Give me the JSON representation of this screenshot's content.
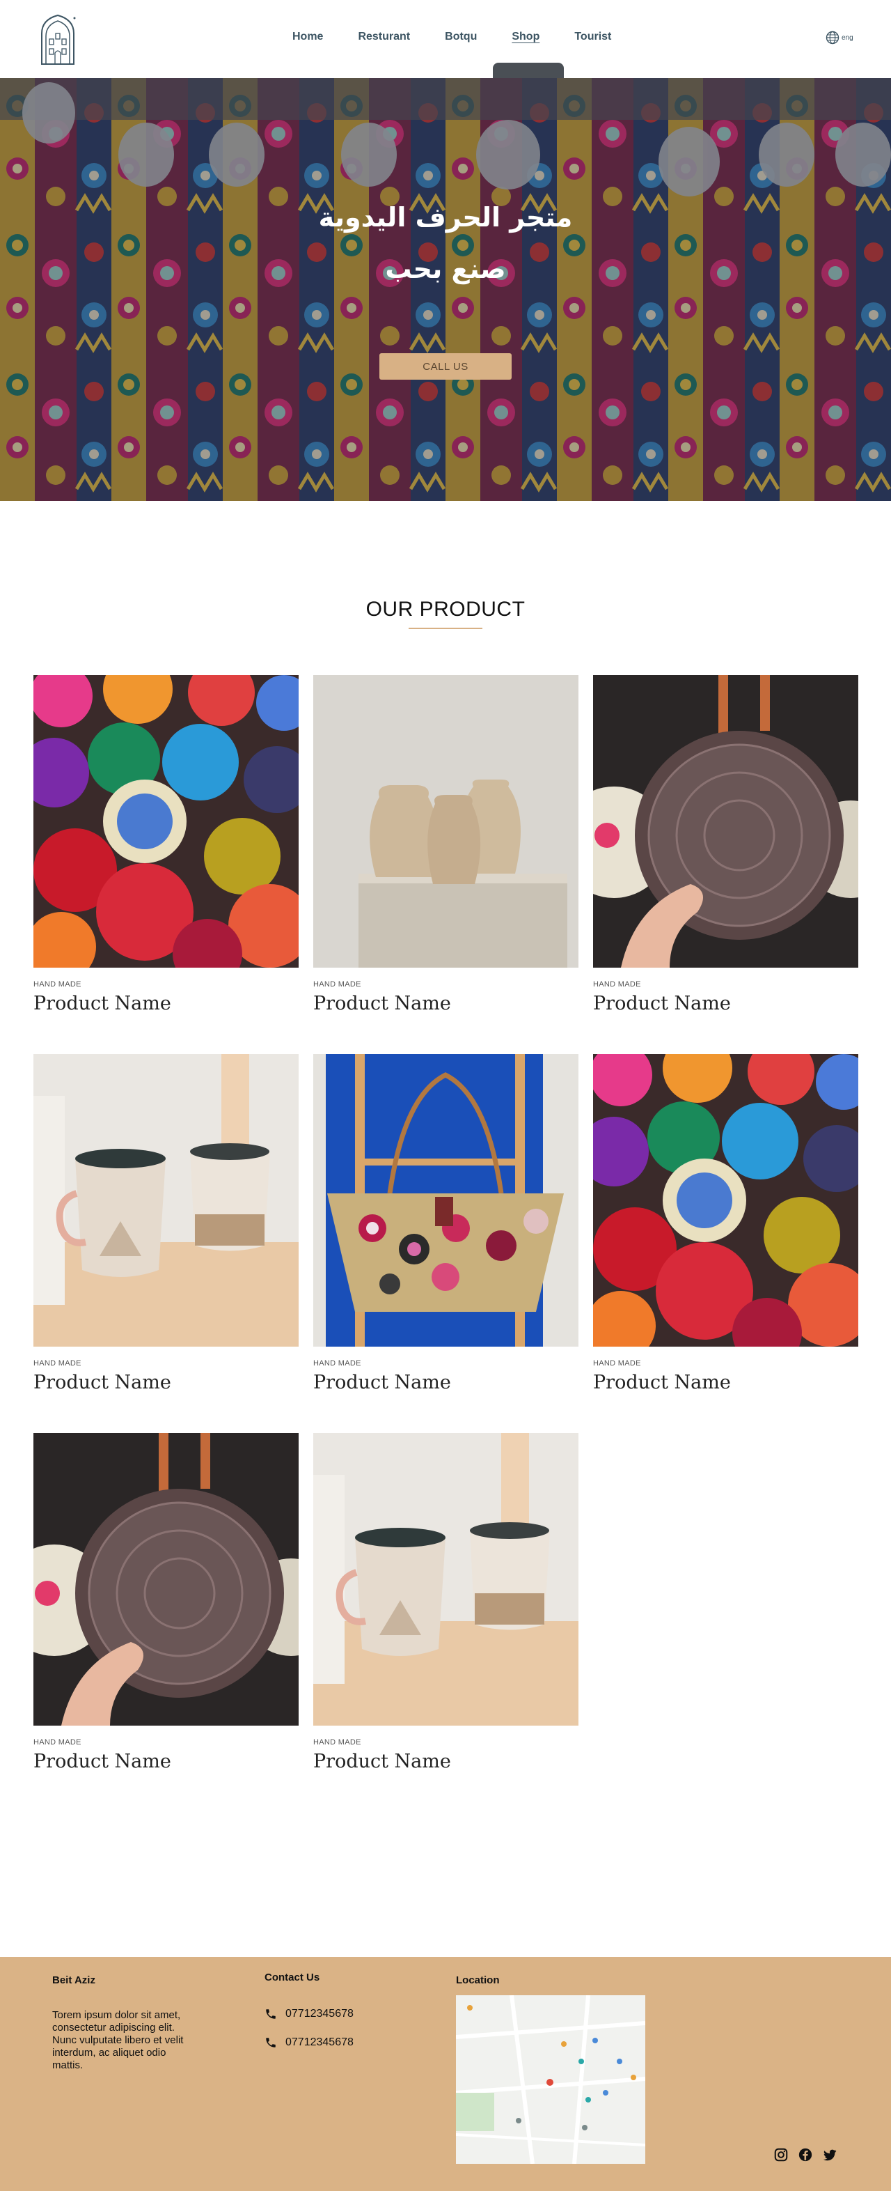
{
  "header": {
    "nav": [
      {
        "label": "Home",
        "active": false
      },
      {
        "label": "Resturant",
        "active": false
      },
      {
        "label": "Botqu",
        "active": false
      },
      {
        "label": "Shop",
        "active": true
      },
      {
        "label": "Tourist",
        "active": false
      }
    ],
    "language": "eng"
  },
  "hero": {
    "title_line1": "متجر الحرف اليدوية",
    "title_line2": "صنع بحب",
    "cta_label": "CALL US"
  },
  "products": {
    "title": "OUR PRODUCT",
    "items": [
      {
        "tag": "HAND MADE",
        "name": "Product Name",
        "image": "colorful-bowls"
      },
      {
        "tag": "HAND MADE",
        "name": "Product Name",
        "image": "clay-vases"
      },
      {
        "tag": "HAND MADE",
        "name": "Product Name",
        "image": "round-rattan-bag"
      },
      {
        "tag": "HAND MADE",
        "name": "Product Name",
        "image": "ceramic-cups"
      },
      {
        "tag": "HAND MADE",
        "name": "Product Name",
        "image": "straw-tote-bag"
      },
      {
        "tag": "HAND MADE",
        "name": "Product Name",
        "image": "colorful-bowls"
      },
      {
        "tag": "HAND MADE",
        "name": "Product Name",
        "image": "round-rattan-bag"
      },
      {
        "tag": "HAND MADE",
        "name": "Product Name",
        "image": "ceramic-cups"
      }
    ]
  },
  "footer": {
    "brand": "Beit Aziz",
    "description": "Torem ipsum dolor sit amet, consectetur adipiscing elit. Nunc vulputate libero et velit interdum, ac aliquet odio mattis.",
    "contact_title": "Contact Us",
    "phones": [
      "07712345678",
      "07712345678"
    ],
    "location_title": "Location",
    "social": [
      "instagram-icon",
      "facebook-icon",
      "twitter-icon"
    ]
  },
  "colors": {
    "accent": "#dab386",
    "nav_text": "#3d5563",
    "button": "#d8b185"
  }
}
